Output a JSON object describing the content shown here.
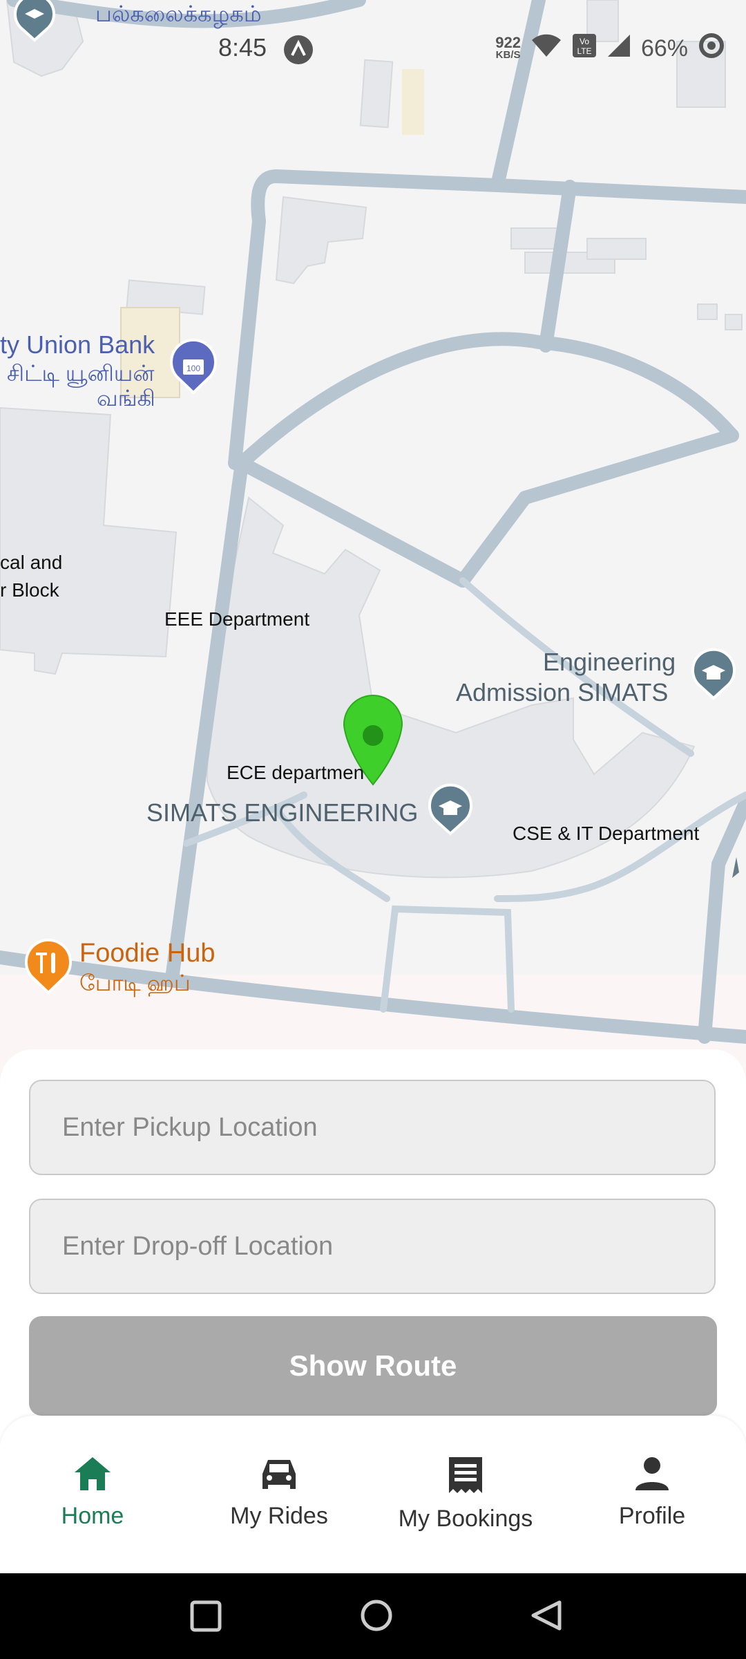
{
  "status_bar": {
    "time": "8:45",
    "net_speed_value": "922",
    "net_speed_unit": "KB/S",
    "battery": "66%",
    "icons": [
      "app-notification-icon",
      "wifi-icon",
      "volte-icon",
      "signal-icon",
      "battery-ring-icon"
    ]
  },
  "map": {
    "labels": {
      "top_tamil": "பல்கலைக்கழகம்",
      "bank_en": "ty Union Bank",
      "bank_ta_1": "சிட்டி யூனியன்",
      "bank_ta_2": "வங்கி",
      "block_1": "cal and",
      "block_2": "r Block",
      "eee": "EEE Department",
      "eng_adm_1": "Engineering",
      "eng_adm_2": "Admission SIMATS",
      "ece": "ECE departmen",
      "simats": "SIMATS ENGINEERING",
      "cse": "CSE & IT Department",
      "foodie_en": "Foodie Hub",
      "foodie_ta": "போடி ஹப்"
    },
    "colors": {
      "road": "#b7c5d1",
      "building": "#e6e7ea",
      "pin": "#3ecf2a",
      "education_poi": "#5f7d8c",
      "bank_poi": "#5c6bc0",
      "food_poi": "#f28a1b"
    }
  },
  "form": {
    "pickup_placeholder": "Enter Pickup Location",
    "dropoff_placeholder": "Enter Drop-off Location",
    "show_route": "Show Route"
  },
  "bottom_nav": {
    "items": [
      {
        "label": "Home",
        "icon": "home-icon",
        "active": true
      },
      {
        "label": "My Rides",
        "icon": "car-icon",
        "active": false
      },
      {
        "label": "My Bookings",
        "icon": "receipt-icon",
        "active": false
      },
      {
        "label": "Profile",
        "icon": "person-icon",
        "active": false
      }
    ],
    "active_color": "#1b7d55"
  },
  "system_nav": [
    "recents-button",
    "home-button",
    "back-button"
  ]
}
